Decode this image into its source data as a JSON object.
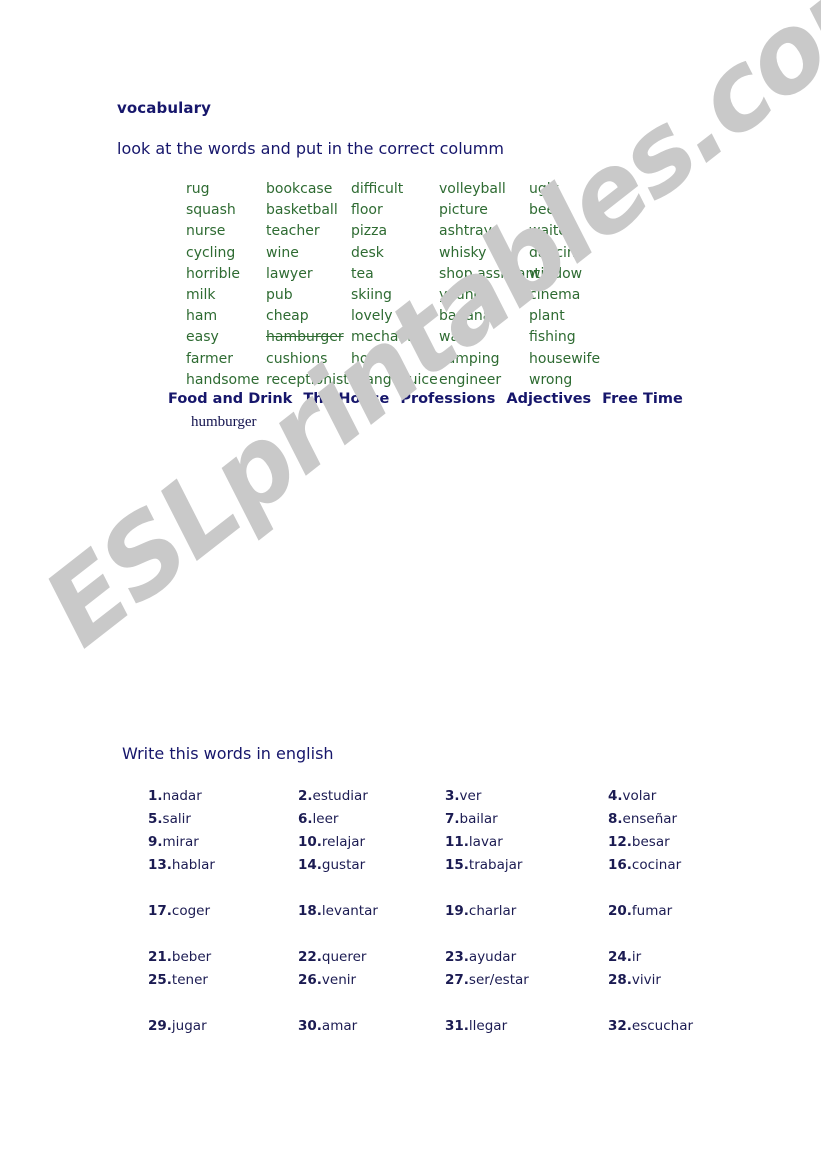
{
  "header": {
    "title": "vocabulary",
    "instruction": "look at the words and put in the correct columm"
  },
  "watermark": {
    "text": "ESLprintables.com",
    "color": "#c9c9c9"
  },
  "colors": {
    "word_green": "#2e6b32",
    "heading_navy": "#16166b",
    "verb_navy": "#1b1b52"
  },
  "word_grid": {
    "rows": [
      [
        "rug",
        "bookcase",
        "difficult",
        "volleyball",
        "ugly"
      ],
      [
        "squash",
        "basketball",
        "floor",
        "picture",
        "beer"
      ],
      [
        "nurse",
        "teacher",
        "pizza",
        "ashtray",
        "waiter"
      ],
      [
        "cycling",
        "wine",
        "desk",
        "whisky",
        "dancing"
      ],
      [
        "horrible",
        "lawyer",
        "tea",
        "shop assistant",
        "window"
      ],
      [
        "milk",
        "pub",
        "skiing",
        "young",
        "cinema"
      ],
      [
        "ham",
        "cheap",
        "lovely",
        "banana",
        "plant"
      ],
      [
        "easy",
        "hamburger",
        "mechanic",
        "wall",
        "fishing"
      ],
      [
        "farmer",
        "cushions",
        "hot",
        "camping",
        "housewife"
      ],
      [
        "handsome",
        "receptionist",
        "orange juice",
        "engineer",
        "wrong"
      ]
    ],
    "struck_through": [
      "hamburger"
    ]
  },
  "categories": [
    "Food and Drink",
    "The House",
    "Professions",
    "Adjectives",
    "Free Time"
  ],
  "answers": {
    "food_and_drink": "humburger"
  },
  "section2": {
    "title": "Write this words in english",
    "entries": [
      {
        "num": "1.",
        "word": "nadar"
      },
      {
        "num": "2.",
        "word": "estudiar"
      },
      {
        "num": "3.",
        "word": "ver"
      },
      {
        "num": "4.",
        "word": "volar"
      },
      {
        "num": "5.",
        "word": "salir"
      },
      {
        "num": "6.",
        "word": "leer"
      },
      {
        "num": "7.",
        "word": "bailar"
      },
      {
        "num": "8.",
        "word": "enseñar"
      },
      {
        "num": "9.",
        "word": "mirar"
      },
      {
        "num": "10.",
        "word": "relajar"
      },
      {
        "num": "11.",
        "word": "lavar"
      },
      {
        "num": "12.",
        "word": "besar"
      },
      {
        "num": "13.",
        "word": "hablar"
      },
      {
        "num": "14.",
        "word": "gustar"
      },
      {
        "num": "15.",
        "word": "trabajar"
      },
      {
        "num": "16.",
        "word": "cocinar"
      },
      {
        "num": "17.",
        "word": "coger"
      },
      {
        "num": "18.",
        "word": "levantar"
      },
      {
        "num": "19.",
        "word": "charlar"
      },
      {
        "num": "20.",
        "word": "fumar"
      },
      {
        "num": "21.",
        "word": "beber"
      },
      {
        "num": "22.",
        "word": "querer"
      },
      {
        "num": "23.",
        "word": "ayudar"
      },
      {
        "num": "24.",
        "word": "ir"
      },
      {
        "num": "25.",
        "word": "tener"
      },
      {
        "num": "26.",
        "word": "venir"
      },
      {
        "num": "27.",
        "word": "ser/estar"
      },
      {
        "num": "28.",
        "word": "vivir"
      },
      {
        "num": "29.",
        "word": "jugar"
      },
      {
        "num": "30.",
        "word": "amar"
      },
      {
        "num": "31.",
        "word": "llegar"
      },
      {
        "num": "32.",
        "word": "escuchar"
      }
    ]
  }
}
